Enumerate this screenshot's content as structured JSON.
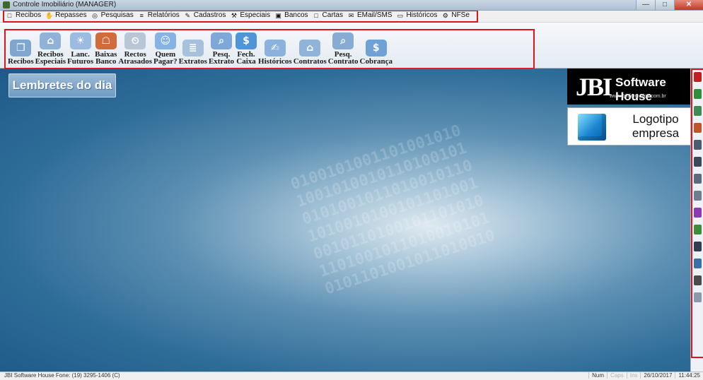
{
  "window": {
    "title": "Controle Imobiliário (MANAGER)"
  },
  "menubar": {
    "items": [
      {
        "label": "Recibos",
        "icon": "doc-icon"
      },
      {
        "label": "Repasses",
        "icon": "hand-icon"
      },
      {
        "label": "Pesquisas",
        "icon": "binoculars-icon"
      },
      {
        "label": "Relatórios",
        "icon": "report-icon"
      },
      {
        "label": "Cadastros",
        "icon": "register-icon"
      },
      {
        "label": "Especiais",
        "icon": "tools-icon"
      },
      {
        "label": "Bancos",
        "icon": "money-icon"
      },
      {
        "label": "Cartas",
        "icon": "doc-icon"
      },
      {
        "label": "EMail/SMS",
        "icon": "mail-icon"
      },
      {
        "label": "Históricos",
        "icon": "monitor-icon"
      },
      {
        "label": "NFSe",
        "icon": "nfse-icon"
      }
    ]
  },
  "toolbar": {
    "buttons": [
      {
        "label": "Recibos",
        "icon": "receipt-icon",
        "color": "#7fa6cf"
      },
      {
        "label": "Recibos Especiais",
        "icon": "house-icon",
        "color": "#8fb2d6"
      },
      {
        "label": "Lanc. Futuros",
        "icon": "bulb-icon",
        "color": "#9cbbe0"
      },
      {
        "label": "Baixas Banco",
        "icon": "bank-icon",
        "color": "#d26b3a"
      },
      {
        "label": "Rectos Atrasados",
        "icon": "late-icon",
        "color": "#b8c6d6"
      },
      {
        "label": "Quem Pagar?",
        "icon": "people-icon",
        "color": "#86b3e3"
      },
      {
        "label": "Extratos",
        "icon": "statement-icon",
        "color": "#a7c0dc"
      },
      {
        "label": "Pesq. Extrato",
        "icon": "search-statement-icon",
        "color": "#7fa8d9"
      },
      {
        "label": "Fech. Caixa",
        "icon": "dollar-icon",
        "color": "#4f95d8"
      },
      {
        "label": "Históricos",
        "icon": "history-icon",
        "color": "#8bb1dc"
      },
      {
        "label": "Contratos",
        "icon": "contract-icon",
        "color": "#90b3d9"
      },
      {
        "label": "Pesq. Contrato",
        "icon": "search-contract-icon",
        "color": "#88abd3"
      },
      {
        "label": "Cobrança",
        "icon": "laptop-dollar-icon",
        "color": "#6fa1d6"
      }
    ]
  },
  "main": {
    "reminders_label": "Lembretes do dia",
    "brand": {
      "mark": "JBI",
      "name": "Software House",
      "url": "www.jbinformatica.com.br"
    },
    "logo_box": {
      "line1": "Logotipo",
      "line2": "empresa"
    }
  },
  "side_icons": [
    {
      "icon": "exit-icon",
      "color": "#c21e1e"
    },
    {
      "icon": "help-icon",
      "color": "#2f8f3a"
    },
    {
      "icon": "map-icon",
      "color": "#3e8c54"
    },
    {
      "icon": "calendar-icon",
      "color": "#c0542a"
    },
    {
      "icon": "calculator-icon",
      "color": "#4b5c6e"
    },
    {
      "icon": "car-icon",
      "color": "#3b4a59"
    },
    {
      "icon": "envelope-icon",
      "color": "#5b6b7b"
    },
    {
      "icon": "printer-icon",
      "color": "#6d7e8f"
    },
    {
      "icon": "building-icon",
      "color": "#8a3ab5"
    },
    {
      "icon": "chart-icon",
      "color": "#3b8c3b"
    },
    {
      "icon": "person-icon",
      "color": "#2f3f4f"
    },
    {
      "icon": "table-icon",
      "color": "#3a6fa8"
    },
    {
      "icon": "people-group-icon",
      "color": "#4b4b4b"
    },
    {
      "icon": "remote-icon",
      "color": "#8a9aab"
    }
  ],
  "statusbar": {
    "left": "JBI Software House Fone: (19) 3295-1406 (C)",
    "num": "Num",
    "caps": "Caps",
    "ins": "Ins",
    "date": "26/10/2017",
    "time": "11:44:25"
  },
  "colors": {
    "accent_red": "#e0141a",
    "desktop_blue": "#2f6d99"
  }
}
